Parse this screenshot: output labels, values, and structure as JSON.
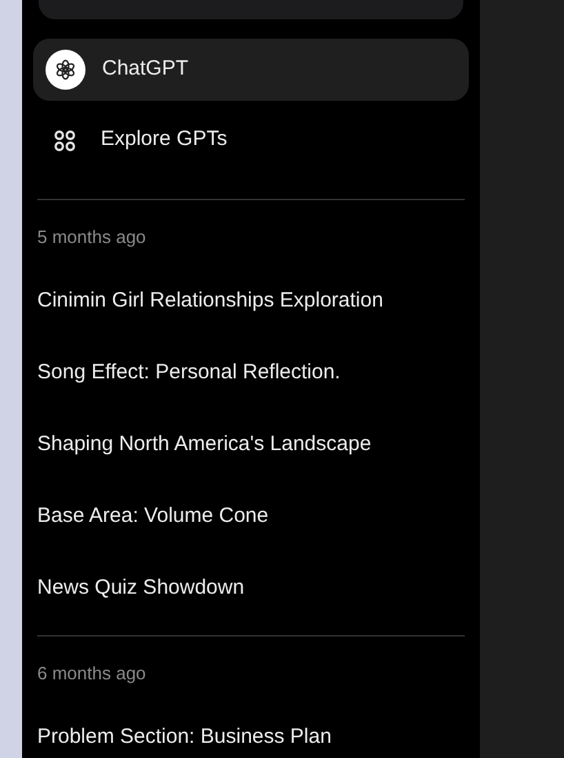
{
  "nav": [
    {
      "kind": "chatgpt",
      "label": "ChatGPT",
      "selected": true
    },
    {
      "kind": "explore",
      "label": "Explore GPTs",
      "selected": false
    }
  ],
  "history": [
    {
      "label": "5 months ago",
      "items": [
        "Cinimin Girl Relationships Exploration",
        "Song Effect: Personal Reflection.",
        "Shaping North America's Landscape",
        "Base Area: Volume Cone",
        "News Quiz Showdown"
      ]
    },
    {
      "label": "6 months ago",
      "items": [
        "Problem Section: Business Plan"
      ]
    }
  ]
}
